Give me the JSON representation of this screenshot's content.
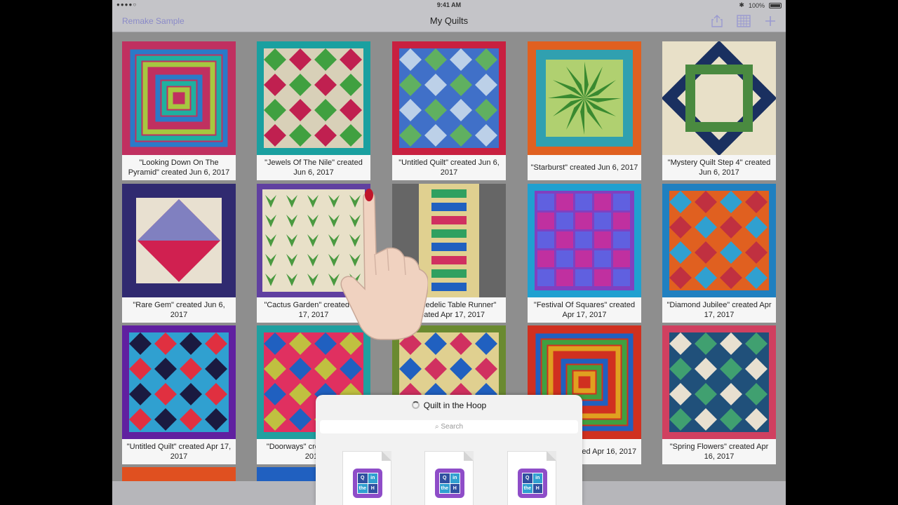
{
  "status": {
    "signal": "●●●●○",
    "time": "9:41 AM",
    "battery": "100%"
  },
  "nav": {
    "left_button": "Remake Sample",
    "title": "My Quilts",
    "icons": [
      "share-icon",
      "grid-icon",
      "plus-icon"
    ]
  },
  "quilts": [
    {
      "caption": "\"Looking Down On The Pyramid\" created Jun 6, 2017",
      "colors": [
        "#c03060",
        "#2a7ac8",
        "#1fb0a0",
        "#a6c840"
      ]
    },
    {
      "caption": "\"Jewels Of The Nile\" created Jun 6, 2017",
      "colors": [
        "#1aa0a0",
        "#d8d0b8",
        "#c02050",
        "#40a040"
      ]
    },
    {
      "caption": "\"Untitled Quilt\" created Jun 6, 2017",
      "colors": [
        "#c82040",
        "#4070c8",
        "#60b060",
        "#bcd0e8"
      ]
    },
    {
      "caption": "\"Starburst\" created Jun 6, 2017",
      "colors": [
        "#e06020",
        "#30a0b0",
        "#3a8a30",
        "#b0d070"
      ]
    },
    {
      "caption": "\"Mystery Quilt Step 4\" created Jun 6, 2017",
      "colors": [
        "#1a3060",
        "#e8e0c8",
        "#4a8a40",
        "#20406a"
      ]
    },
    {
      "caption": "\"Rare Gem\" created Jun 6, 2017",
      "colors": [
        "#302a70",
        "#e8e0d0",
        "#d02050",
        "#8080c0"
      ]
    },
    {
      "caption": "\"Cactus Garden\" created Apr 17, 2017",
      "colors": [
        "#6040a0",
        "#e8e0c8",
        "#4a9a40",
        "#6a3a9a"
      ]
    },
    {
      "caption": "\"Psychedelic Table Runner\" created Apr 17, 2017",
      "colors": [
        "#30a060",
        "#e0d090",
        "#2060c0",
        "#d03060"
      ]
    },
    {
      "caption": "\"Festival Of Squares\" created Apr 17, 2017",
      "colors": [
        "#20a0d0",
        "#8040c0",
        "#c030a0",
        "#6060e0"
      ]
    },
    {
      "caption": "\"Diamond Jubilee\" created Apr 17, 2017",
      "colors": [
        "#2080c0",
        "#e06020",
        "#c03040",
        "#30a0d0"
      ]
    },
    {
      "caption": "\"Untitled Quilt\" created Apr 17, 2017",
      "colors": [
        "#6020a0",
        "#30a0d0",
        "#e03040",
        "#1a1a40"
      ]
    },
    {
      "caption": "\"Doorways\" created Apr 17, 2017",
      "colors": [
        "#20a0a0",
        "#e03060",
        "#c0c040",
        "#2060c0"
      ]
    },
    {
      "caption": "",
      "colors": [
        "#6a8a30",
        "#e0d090",
        "#2060c0",
        "#d03060"
      ]
    },
    {
      "caption": "Corners\" created Apr 16, 2017",
      "colors": [
        "#d03020",
        "#2060c0",
        "#40a040",
        "#e0a020"
      ]
    },
    {
      "caption": "\"Spring Flowers\" created Apr 16, 2017",
      "colors": [
        "#d04060",
        "#20507a",
        "#40a070",
        "#e8e0d0"
      ]
    }
  ],
  "sheet": {
    "title": "Quilt in the Hoop",
    "search_placeholder": "Search",
    "docs": [
      {
        "letters": [
          "Q",
          "in",
          "the",
          "H"
        ]
      },
      {
        "letters": [
          "Q",
          "in",
          "the",
          "H"
        ]
      },
      {
        "letters": [
          "Q",
          "in",
          "the",
          "H"
        ]
      }
    ]
  }
}
